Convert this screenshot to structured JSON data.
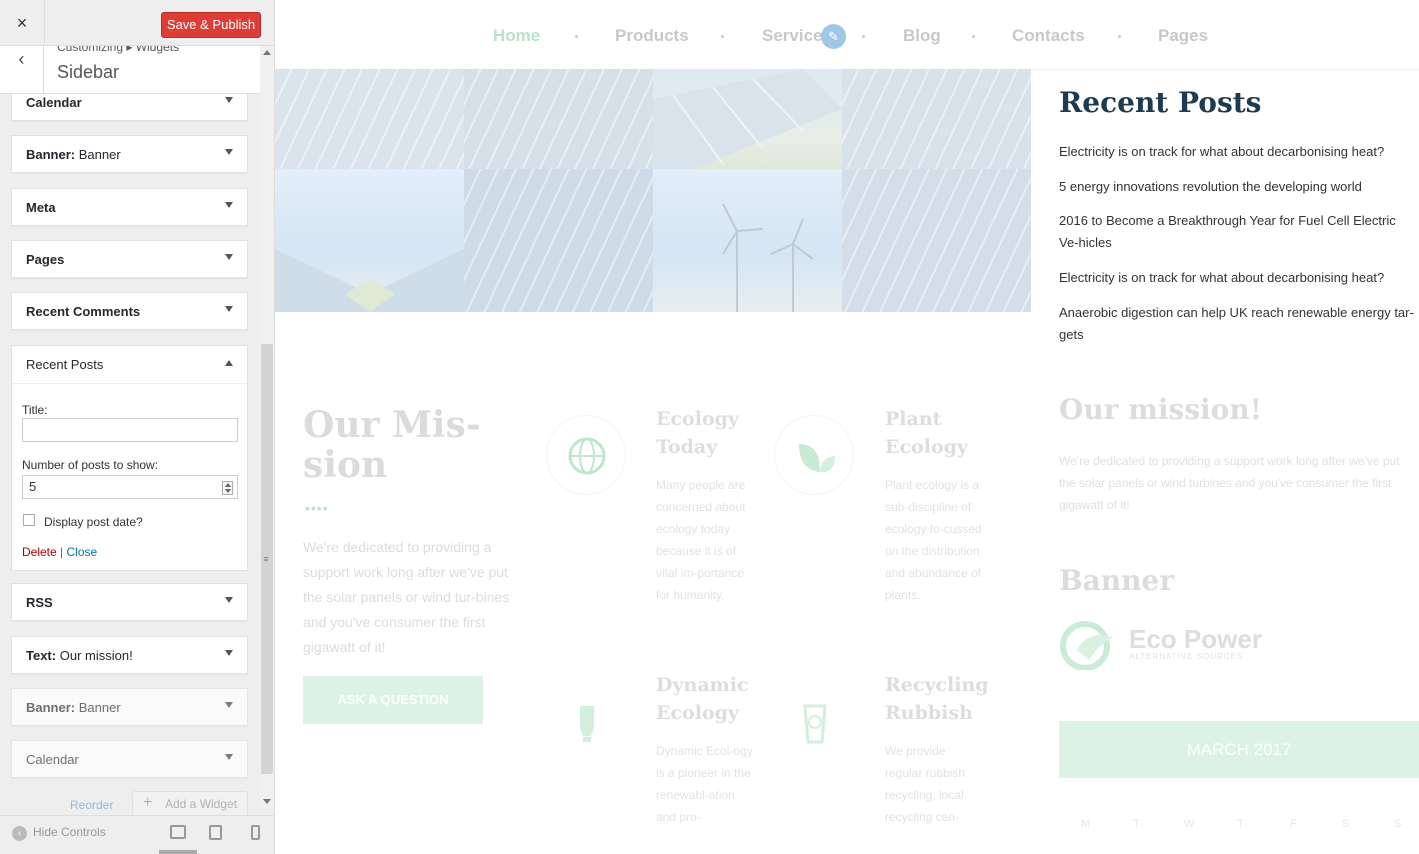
{
  "customizer": {
    "close_icon": "×",
    "save_label": "Save & Publish",
    "breadcrumb": "Customizing ▸ Widgets",
    "section_title": "Sidebar",
    "widgets_above": [
      {
        "type": "Calendar",
        "name": ""
      },
      {
        "type": "Banner:",
        "name": "Banner"
      },
      {
        "type": "Meta",
        "name": ""
      },
      {
        "type": "Pages",
        "name": ""
      },
      {
        "type": "Recent Comments",
        "name": ""
      }
    ],
    "expanded_widget": {
      "type": "Recent Posts",
      "title_label": "Title:",
      "title_value": "",
      "number_label": "Number of posts to show:",
      "number_value": "5",
      "display_date_label": "Display post date?",
      "delete_label": "Delete",
      "separator": "|",
      "close_label": "Close"
    },
    "widgets_below": [
      {
        "type": "RSS",
        "name": ""
      },
      {
        "type": "Text:",
        "name": "Our mission!"
      },
      {
        "type": "Banner:",
        "name": "Banner"
      },
      {
        "type": "Calendar",
        "name": ""
      }
    ],
    "reorder_label": "Reorder",
    "add_widget_label": "Add a Widget",
    "hide_controls_label": "Hide Controls"
  },
  "preview": {
    "nav": [
      "Home",
      "Products",
      "Service",
      "Blog",
      "Contacts",
      "Pages"
    ],
    "mission": {
      "heading": "Our Mis-sion",
      "dots": "••••",
      "text": "We're dedicated to providing a support work long after we've put the solar panels or wind tur-bines and you've consumer the first gigawatt of it!",
      "button": "ASK A QUESTION"
    },
    "features": [
      {
        "title": "Ecology Today",
        "text": "Many people are concerned about ecology today because it is of vital im-portance for humanity.",
        "icon": "globe-icon"
      },
      {
        "title": "Plant Ecology",
        "text": "Plant ecology is a sub-discipline of ecology fo-cussed on the distribution and abundance of plants.",
        "icon": "leaf-icon"
      },
      {
        "title": "Dynamic Ecology",
        "text": "Dynamic Ecol-ogy is a pioneer in the renewabl-ation and pro-",
        "icon": "bulb-icon"
      },
      {
        "title": "Recycling Rubbish",
        "text": "We provide regular rubbish recycling, local recycling cen-",
        "icon": "recycle-bin-icon"
      }
    ],
    "sidebar": {
      "recent_posts_heading": "Recent Posts",
      "posts": [
        "Electricity is on track for what about decarbonising heat?",
        "5 energy innovations revolution the developing world",
        "2016 to Become a Breakthrough Year for Fuel Cell Electric Ve-hicles",
        "Electricity is on track for what about decarbonising heat?",
        "Anaerobic digestion can help UK reach renewable energy tar-gets"
      ],
      "mission_heading": "Our mission!",
      "mission_text": "We're dedicated to providing a support work long after we've put the solar panels or wind turbines and you've consumer the first gigawatt of it!",
      "banner_heading": "Banner",
      "logo_name": "Eco Power",
      "logo_sub": "ALTERNATIVE SOURCES",
      "calendar_month": "MARCH 2017",
      "calendar_days": [
        "M",
        "T",
        "W",
        "T",
        "F",
        "S",
        "S"
      ]
    }
  },
  "colors": {
    "save_button": "#dd3d36",
    "nav_active": "#b8e0cb",
    "accent_green": "#dcf2e5",
    "heading_dark": "#1e3a50",
    "edit_shortcut": "#9ec9e6"
  }
}
